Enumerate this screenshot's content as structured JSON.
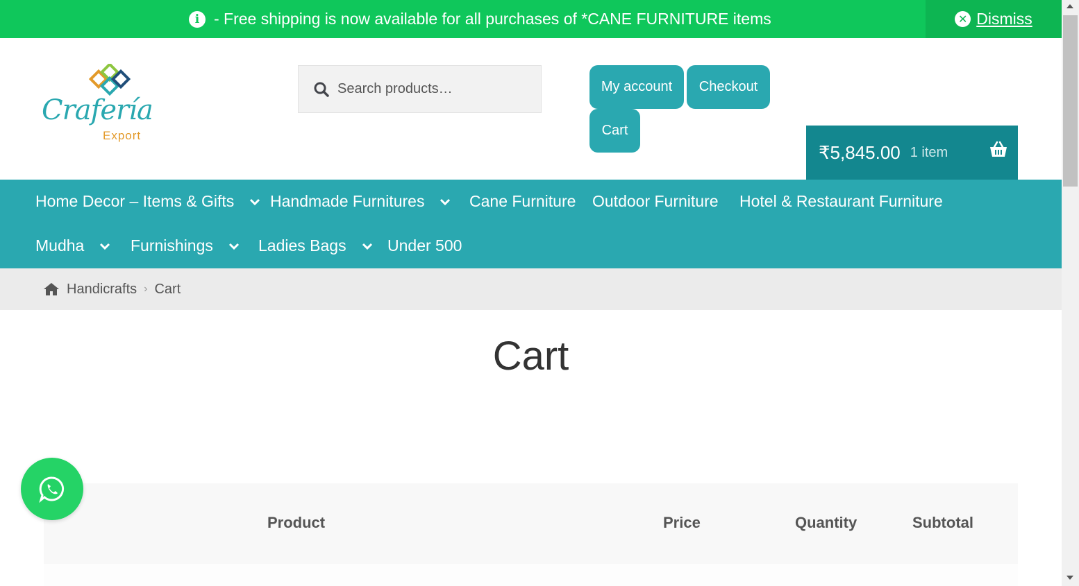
{
  "notice": {
    "message": "- Free shipping is now available for all purchases of *CANE FURNITURE items",
    "dismiss_label": "Dismiss"
  },
  "logo": {
    "name": "Crafería",
    "sub": "Export"
  },
  "search": {
    "placeholder": "Search products…"
  },
  "header_buttons": {
    "my_account": "My account",
    "checkout": "Checkout",
    "cart": "Cart"
  },
  "mini_cart": {
    "amount": "₹5,845.00",
    "count": "1 item"
  },
  "nav": {
    "items": [
      {
        "label": "Home Decor – Items & Gifts",
        "has_dropdown": true
      },
      {
        "label": "Handmade Furnitures",
        "has_dropdown": true
      },
      {
        "label": "Cane Furniture",
        "has_dropdown": false
      },
      {
        "label": "Outdoor Furniture",
        "has_dropdown": false
      },
      {
        "label": "Hotel & Restaurant Furniture",
        "has_dropdown": false
      },
      {
        "label": "Mudha",
        "has_dropdown": true
      },
      {
        "label": "Furnishings",
        "has_dropdown": true
      },
      {
        "label": "Ladies Bags",
        "has_dropdown": true
      },
      {
        "label": "Under 500",
        "has_dropdown": false
      }
    ]
  },
  "breadcrumb": {
    "home": "Handicrafts",
    "current": "Cart"
  },
  "page": {
    "title": "Cart"
  },
  "cart_table": {
    "headers": {
      "product": "Product",
      "price": "Price",
      "quantity": "Quantity",
      "subtotal": "Subtotal"
    }
  },
  "colors": {
    "notice": "#0fc75b",
    "brand": "#2aa8b0",
    "cart_box": "#13878f",
    "whatsapp": "#25d366"
  },
  "icons": [
    "info-icon",
    "close-circle-icon",
    "search-icon",
    "basket-icon",
    "chevron-down-icon",
    "home-icon",
    "whatsapp-icon"
  ]
}
